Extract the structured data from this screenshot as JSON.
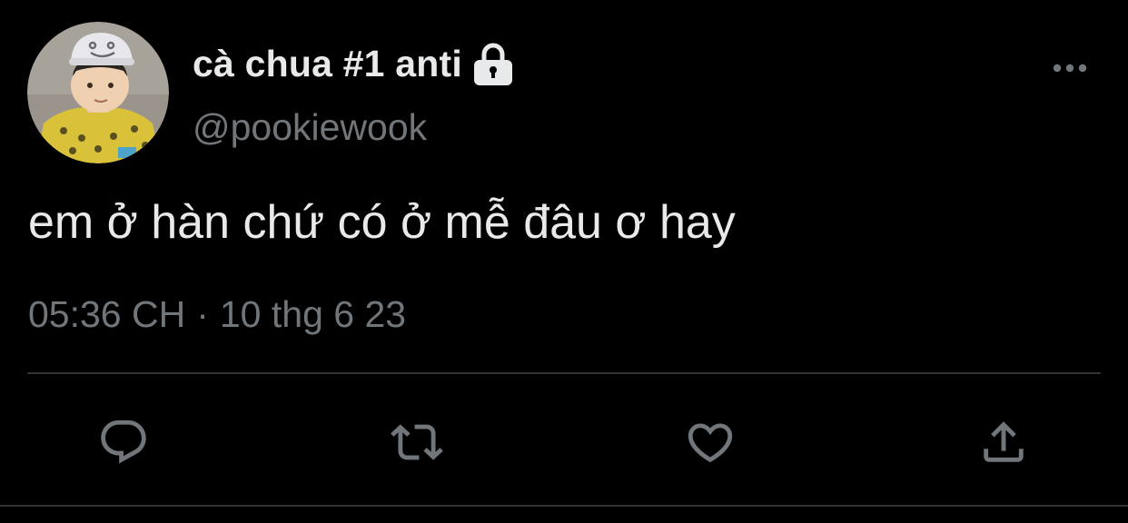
{
  "user": {
    "display_name": "cà chua #1 anti",
    "handle": "@pookiewook",
    "protected_icon": "lock-icon",
    "avatar": "avatar-photo"
  },
  "tweet": {
    "text": "em ở hàn chứ có ở mễ đâu ơ hay",
    "time": "05:36 CH",
    "separator": "·",
    "date": "10 thg 6 23"
  },
  "actions": [
    {
      "icon": "reply-icon"
    },
    {
      "icon": "retweet-icon"
    },
    {
      "icon": "like-icon"
    },
    {
      "icon": "share-icon"
    }
  ],
  "menu_icon": "more-icon",
  "colors": {
    "background": "#000000",
    "primary_text": "#e7e9ea",
    "secondary_text": "#71767b",
    "divider": "#2f3336"
  }
}
